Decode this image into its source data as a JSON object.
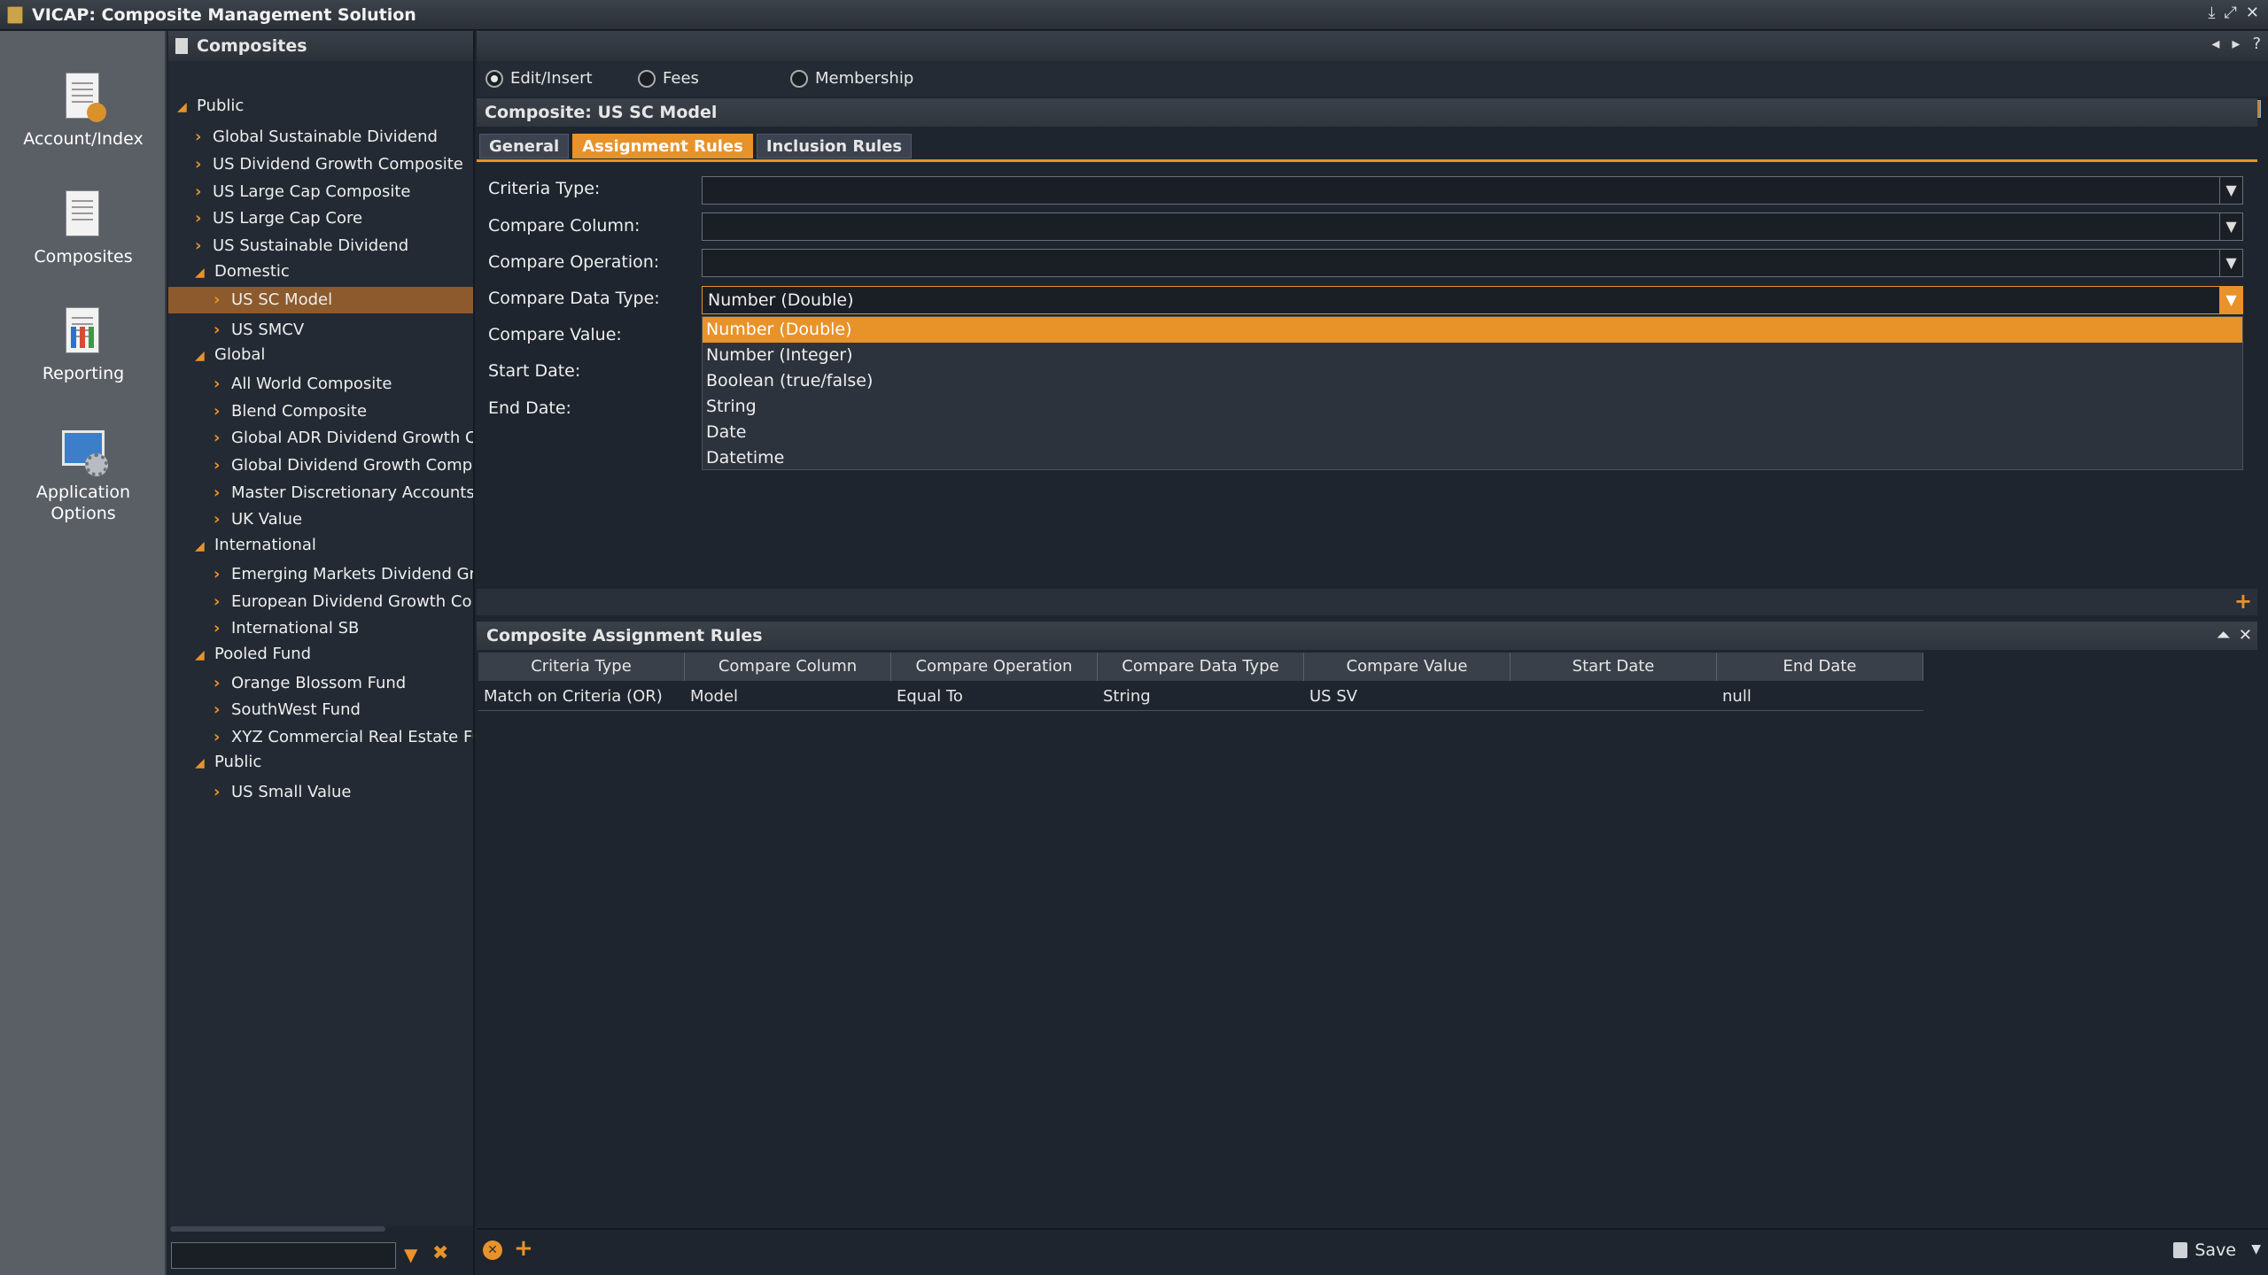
{
  "window": {
    "title": "VICAP: Composite Management Solution"
  },
  "nav": [
    {
      "label": "Account/Index"
    },
    {
      "label": "Composites"
    },
    {
      "label": "Reporting"
    },
    {
      "label": "Application Options"
    }
  ],
  "tree": {
    "header": "Composites",
    "nodes": [
      {
        "label": "Public",
        "depth": 0,
        "expanded": true
      },
      {
        "label": "Global Sustainable Dividend",
        "depth": 1
      },
      {
        "label": "US Dividend Growth Composite",
        "depth": 1
      },
      {
        "label": "US Large Cap Composite",
        "depth": 1
      },
      {
        "label": "US Large Cap Core",
        "depth": 1
      },
      {
        "label": "US Sustainable Dividend",
        "depth": 1
      },
      {
        "label": "Domestic",
        "depth": 1,
        "expanded": true
      },
      {
        "label": "US SC Model",
        "depth": 2,
        "selected": true
      },
      {
        "label": "US SMCV",
        "depth": 2
      },
      {
        "label": "Global",
        "depth": 1,
        "expanded": true
      },
      {
        "label": "All World Composite",
        "depth": 2
      },
      {
        "label": "Blend Composite",
        "depth": 2
      },
      {
        "label": "Global ADR Dividend Growth C",
        "depth": 2
      },
      {
        "label": "Global Dividend Growth Compo",
        "depth": 2
      },
      {
        "label": "Master Discretionary Accounts",
        "depth": 2
      },
      {
        "label": "UK Value",
        "depth": 2
      },
      {
        "label": "International",
        "depth": 1,
        "expanded": true
      },
      {
        "label": "Emerging Markets Dividend Gr",
        "depth": 2
      },
      {
        "label": "European Dividend Growth Co",
        "depth": 2
      },
      {
        "label": "International SB",
        "depth": 2
      },
      {
        "label": "Pooled Fund",
        "depth": 1,
        "expanded": true
      },
      {
        "label": "Orange Blossom Fund",
        "depth": 2
      },
      {
        "label": "SouthWest Fund",
        "depth": 2
      },
      {
        "label": "XYZ Commercial Real Estate Fu",
        "depth": 2
      },
      {
        "label": "Public",
        "depth": 1,
        "expanded": true
      },
      {
        "label": "US Small Value",
        "depth": 2
      }
    ],
    "search_value": ""
  },
  "mode": {
    "options": [
      "Edit/Insert",
      "Fees",
      "Membership"
    ],
    "selected": "Edit/Insert"
  },
  "composite_title": "Composite: US SC Model",
  "tabs": [
    {
      "label": "General",
      "active": false
    },
    {
      "label": "Assignment Rules",
      "active": true
    },
    {
      "label": "Inclusion Rules",
      "active": false
    }
  ],
  "form": {
    "criteria_type": {
      "label": "Criteria Type:",
      "value": ""
    },
    "compare_column": {
      "label": "Compare Column:",
      "value": ""
    },
    "compare_operation": {
      "label": "Compare Operation:",
      "value": ""
    },
    "compare_data_type": {
      "label": "Compare Data Type:",
      "value": "Number (Double)"
    },
    "compare_value": {
      "label": "Compare Value:"
    },
    "start_date": {
      "label": "Start Date:"
    },
    "end_date": {
      "label": "End Date:"
    }
  },
  "dropdown_options": [
    "Number (Double)",
    "Number (Integer)",
    "Boolean (true/false)",
    "String",
    "Date",
    "Datetime"
  ],
  "dropdown_selected": "Number (Double)",
  "grid": {
    "title": "Composite Assignment Rules",
    "columns": [
      "Criteria Type",
      "Compare Column",
      "Compare Operation",
      "Compare Data Type",
      "Compare Value",
      "Start Date",
      "End Date"
    ],
    "rows": [
      [
        "Match on Criteria (OR)",
        "Model",
        "Equal To",
        "String",
        "US SV",
        "",
        "null"
      ]
    ]
  },
  "footer": {
    "save_label": "Save"
  },
  "colors": {
    "accent": "#e8922a",
    "background": "#1e252e",
    "nav": "#5a5f66"
  }
}
